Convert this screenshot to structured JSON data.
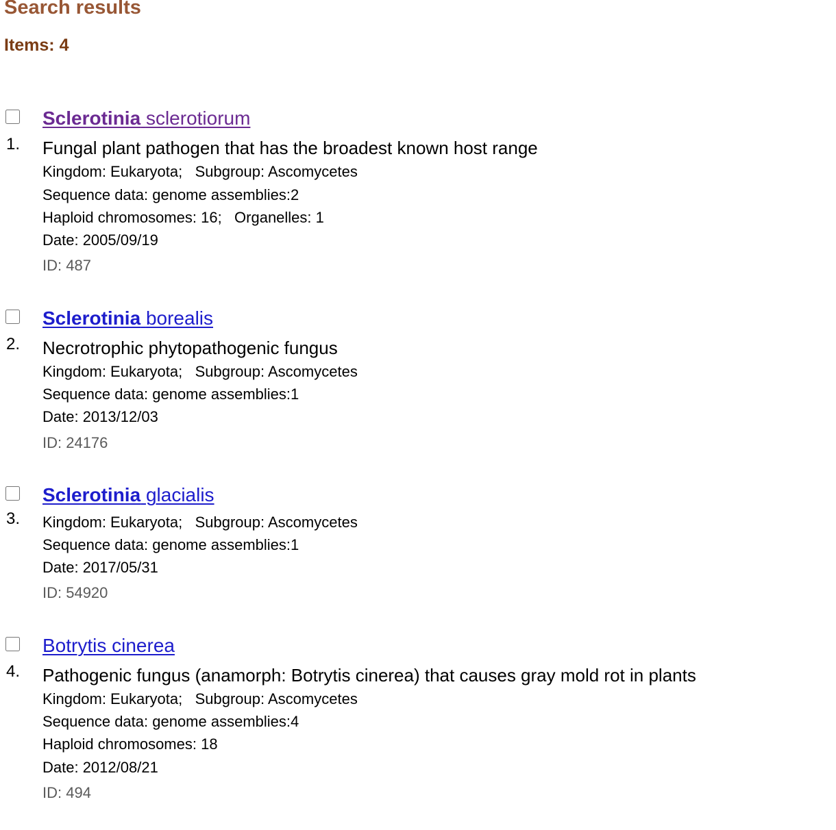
{
  "header": {
    "title": "Search results",
    "items_count": "Items: 4"
  },
  "results": [
    {
      "number": "1.",
      "genus": "Sclerotinia",
      "species": "sclerotiorum",
      "visited": true,
      "description": "Fungal plant pathogen that has the broadest known host range",
      "kingdom": "Kingdom: Eukaryota;",
      "subgroup": "Subgroup: Ascomycetes",
      "sequence": "Sequence data: genome assemblies:2",
      "chromosomes": "Haploid chromosomes: 16;",
      "organelles": "Organelles: 1",
      "date": "Date: 2005/09/19",
      "id": "ID: 487"
    },
    {
      "number": "2.",
      "genus": "Sclerotinia",
      "species": "borealis",
      "visited": false,
      "description": "Necrotrophic phytopathogenic fungus",
      "kingdom": "Kingdom: Eukaryota;",
      "subgroup": "Subgroup: Ascomycetes",
      "sequence": "Sequence data: genome assemblies:1",
      "date": "Date: 2013/12/03",
      "id": "ID: 24176"
    },
    {
      "number": "3.",
      "genus": "Sclerotinia",
      "species": "glacialis",
      "visited": false,
      "kingdom": "Kingdom: Eukaryota;",
      "subgroup": "Subgroup: Ascomycetes",
      "sequence": "Sequence data: genome assemblies:1",
      "date": "Date: 2017/05/31",
      "id": "ID: 54920"
    },
    {
      "number": "4.",
      "title": "Botrytis cinerea",
      "visited": false,
      "description": "Pathogenic fungus (anamorph: Botrytis cinerea) that causes gray mold rot in plants",
      "kingdom": "Kingdom: Eukaryota;",
      "subgroup": "Subgroup: Ascomycetes",
      "sequence": "Sequence data: genome assemblies:4",
      "chromosomes": "Haploid chromosomes: 18",
      "date": "Date: 2012/08/21",
      "id": "ID: 494"
    }
  ],
  "colors": {
    "title": "#985735",
    "items_count": "#7a3c14",
    "link_visited": "#6b2a92",
    "link_unvisited": "#1d1dcc",
    "id_text": "#5a5a5a"
  }
}
